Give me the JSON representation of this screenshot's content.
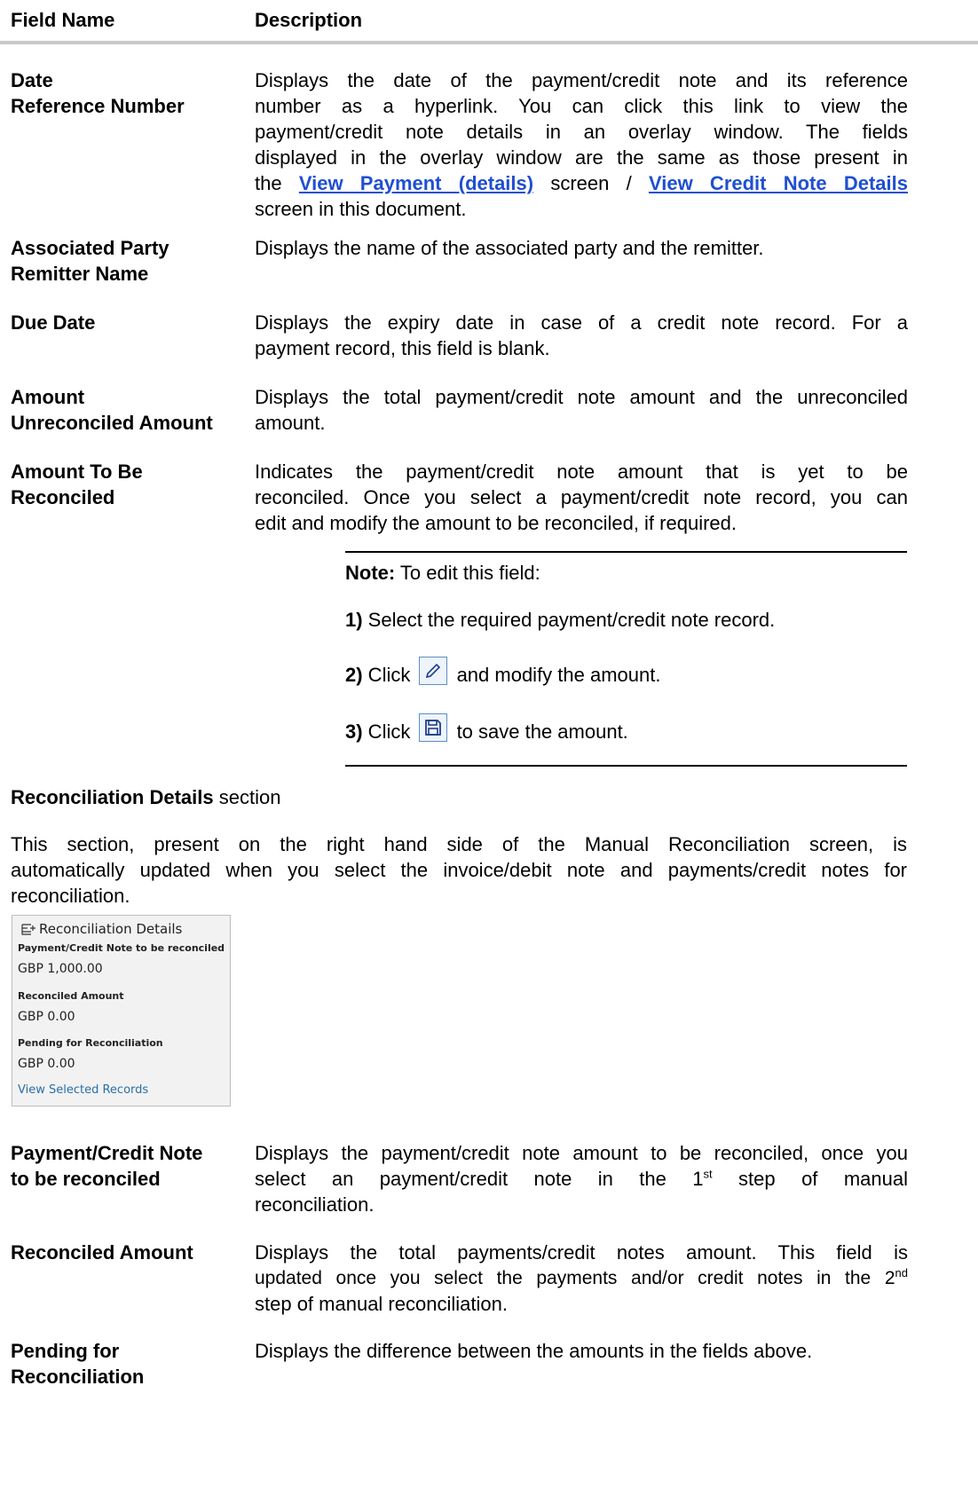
{
  "table": {
    "header": {
      "field_name": "Field Name",
      "description": "Description"
    },
    "rows": [
      {
        "name_lines": [
          "Date",
          "Reference Number"
        ]
      },
      {
        "name_lines": [
          "Associated Party",
          "Remitter Name"
        ],
        "description": "Displays the name of the associated party and the remitter."
      },
      {
        "name_lines": [
          "Due Date"
        ],
        "description_lines": [
          "Displays the expiry date in case of a credit note record. For a",
          "payment record, this field is blank."
        ]
      },
      {
        "name_lines": [
          "Amount",
          "Unreconciled Amount"
        ],
        "description_lines": [
          "Displays the total payment/credit note amount and the unreconciled",
          "amount."
        ]
      },
      {
        "name_lines": [
          "Amount To Be",
          "Reconciled"
        ],
        "description_lines": [
          "Indicates the payment/credit note amount that is yet to be",
          "reconciled. Once you select a payment/credit note record, you can",
          "edit and modify the amount to be reconciled, if required."
        ]
      }
    ],
    "date_desc": {
      "l1": "Displays the date of the payment/credit note and its reference",
      "l2": "number as a hyperlink. You can click this link to view the",
      "l3": "payment/credit note details in an overlay window. The fields",
      "l4": "displayed in the overlay window are the same as those present in",
      "l5_pre": "the ",
      "link1": "View Payment (details)",
      "l5_mid": " screen / ",
      "link2": "View Credit Note Details",
      "l6": "screen in this document."
    }
  },
  "note": {
    "label": "Note:",
    "text": " To edit this field:",
    "step1_num": "1)",
    "step1_text": " Select the required payment/credit note record.",
    "step2_num": "2)",
    "step2_pre": " Click ",
    "step2_post": " and modify the amount.",
    "step3_num": "3)",
    "step3_pre": " Click ",
    "step3_post": " to save the amount.",
    "edit_icon": "pencil-icon",
    "save_icon": "floppy-disk-icon"
  },
  "section": {
    "title_bold": "Reconciliation Details",
    "title_rest": " section",
    "para_lines": [
      "This section, present on the right hand side of the Manual Reconciliation screen, is",
      "automatically updated when you select the invoice/debit note and payments/credit notes for",
      "reconciliation."
    ]
  },
  "card": {
    "title": "Reconciliation Details",
    "icon": "reconcile-icon",
    "items": [
      {
        "label": "Payment/Credit Note to be reconciled",
        "value": "GBP 1,000.00"
      },
      {
        "label": "Reconciled Amount",
        "value": "GBP 0.00"
      },
      {
        "label": "Pending for Reconciliation",
        "value": "GBP 0.00"
      }
    ],
    "link": "View Selected Records"
  },
  "fields2": [
    {
      "name_lines": [
        "Payment/Credit Note",
        "to be reconciled"
      ],
      "d1": "Displays the payment/credit note amount to be reconciled, once you",
      "d2_pre": "select an payment/credit note in the 1",
      "d2_sup": "st",
      "d2_post": " step of manual",
      "d3": "reconciliation."
    },
    {
      "name_lines": [
        "Reconciled Amount"
      ],
      "d1": "Displays the total payments/credit notes amount. This field is",
      "d2_pre": "updated once you select the payments and/or credit notes in the 2",
      "d2_sup": "nd",
      "d3": "step of manual reconciliation."
    },
    {
      "name_lines": [
        "Pending for",
        "Reconciliation"
      ],
      "d1": "Displays the difference between the amounts in the fields above."
    }
  ]
}
